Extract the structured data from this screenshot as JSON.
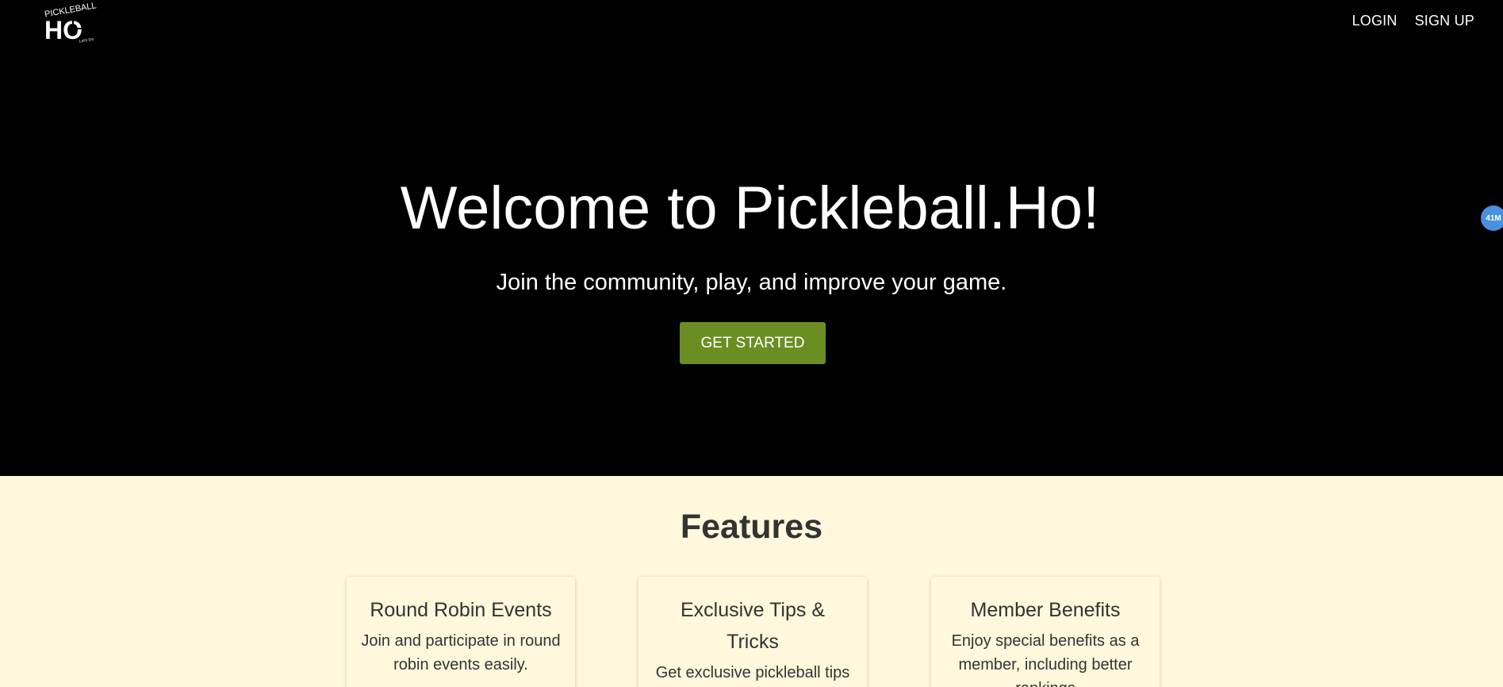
{
  "brand": {
    "logo_text_top": "PICKLEBALL",
    "logo_text_main": "HO",
    "logo_text_small": "Let's Go"
  },
  "nav": {
    "login": "LOGIN",
    "signup": "SIGN UP"
  },
  "hero": {
    "title": "Welcome to Pickleball.Ho!",
    "subtitle": "Join the community, play, and improve your game.",
    "cta": "GET STARTED"
  },
  "floating_badge": "41M",
  "features": {
    "title": "Features",
    "cards": [
      {
        "title": "Round Robin Events",
        "description": "Join and participate in round robin events easily."
      },
      {
        "title": "Exclusive Tips & Tricks",
        "description": "Get exclusive pickleball tips"
      },
      {
        "title": "Member Benefits",
        "description": "Enjoy special benefits as a member, including better rankings"
      }
    ]
  },
  "colors": {
    "hero_bg": "#000000",
    "accent": "#6b8e23",
    "features_bg": "#fff8dc",
    "badge": "#4a90e2"
  }
}
